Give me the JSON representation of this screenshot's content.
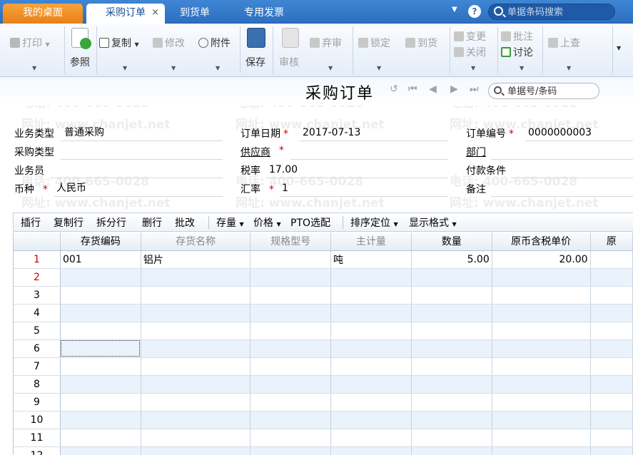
{
  "tabs": {
    "home": "我的桌面",
    "active": "采购订单",
    "t3": "到货单",
    "t4": "专用发票",
    "close": "×"
  },
  "top_search": {
    "placeholder": "单据条码搜索"
  },
  "toolbar": {
    "print": "打印",
    "ref": "参照",
    "copy": "复制",
    "modify": "修改",
    "attach": "附件",
    "save": "保存",
    "audit": "审核",
    "abandon": "弃审",
    "lock": "锁定",
    "arrive": "到货",
    "change": "变更",
    "close": "关闭",
    "annotate": "批注",
    "discuss": "讨论",
    "lookup": "上查"
  },
  "doc": {
    "title": "采购订单",
    "search_placeholder": "单据号/条码"
  },
  "form": {
    "biz_type_label": "业务类型",
    "biz_type": "普通采购",
    "order_date_label": "订单日期",
    "order_date": "2017-07-13",
    "order_no_label": "订单编号",
    "order_no": "0000000003",
    "purchase_type_label": "采购类型",
    "purchase_type": "",
    "supplier_label": "供应商",
    "supplier": "",
    "dept_label": "部门",
    "dept": "",
    "staff_label": "业务员",
    "staff": "",
    "tax_rate_label": "税率",
    "tax_rate": "17.00",
    "payment_label": "付款条件",
    "payment": "",
    "currency_label": "币种",
    "currency": "人民币",
    "exchange_label": "汇率",
    "exchange": "1",
    "remark_label": "备注",
    "remark": ""
  },
  "watermark": {
    "phone": "电话: 400-665-0028",
    "site": "网址: www.chanjet.net"
  },
  "gridbar": {
    "insert": "插行",
    "copy_row": "复制行",
    "split": "拆分行",
    "delete": "删行",
    "batch": "批改",
    "stock": "存量",
    "price": "价格",
    "pto": "PTO选配",
    "sort": "排序定位",
    "format": "显示格式"
  },
  "columns": [
    "存货编码",
    "存货名称",
    "规格型号",
    "主计量",
    "数量",
    "原币含税单价",
    "原"
  ],
  "rows": [
    {
      "n": "1",
      "code": "001",
      "name": "铝片",
      "spec": "",
      "unit": "吨",
      "qty": "5.00",
      "price": "20.00"
    },
    {
      "n": "2",
      "code": "",
      "name": "",
      "spec": "",
      "unit": "",
      "qty": "",
      "price": ""
    },
    {
      "n": "3",
      "code": "",
      "name": "",
      "spec": "",
      "unit": "",
      "qty": "",
      "price": ""
    },
    {
      "n": "4",
      "code": "",
      "name": "",
      "spec": "",
      "unit": "",
      "qty": "",
      "price": ""
    },
    {
      "n": "5",
      "code": "",
      "name": "",
      "spec": "",
      "unit": "",
      "qty": "",
      "price": ""
    },
    {
      "n": "6",
      "code": "",
      "name": "",
      "spec": "",
      "unit": "",
      "qty": "",
      "price": ""
    },
    {
      "n": "7",
      "code": "",
      "name": "",
      "spec": "",
      "unit": "",
      "qty": "",
      "price": ""
    },
    {
      "n": "8",
      "code": "",
      "name": "",
      "spec": "",
      "unit": "",
      "qty": "",
      "price": ""
    },
    {
      "n": "9",
      "code": "",
      "name": "",
      "spec": "",
      "unit": "",
      "qty": "",
      "price": ""
    },
    {
      "n": "10",
      "code": "",
      "name": "",
      "spec": "",
      "unit": "",
      "qty": "",
      "price": ""
    },
    {
      "n": "11",
      "code": "",
      "name": "",
      "spec": "",
      "unit": "",
      "qty": "",
      "price": ""
    },
    {
      "n": "12",
      "code": "",
      "name": "",
      "spec": "",
      "unit": "",
      "qty": "",
      "price": ""
    }
  ],
  "colors": {
    "accent": "#2d6fbf",
    "home_tab": "#f39a2e",
    "required": "#d00000"
  }
}
